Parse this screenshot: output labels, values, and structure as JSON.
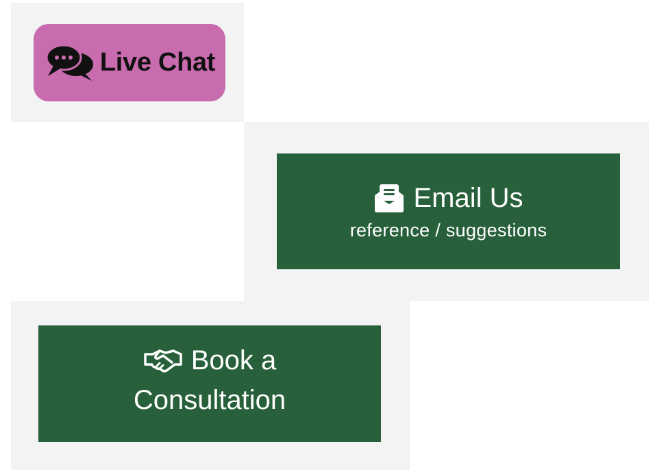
{
  "live_chat": {
    "label": "Live Chat",
    "icon": "chat-bubbles-icon",
    "color": "#c86baf"
  },
  "email": {
    "title": "Email Us",
    "subtitle": "reference / suggestions",
    "icon": "envelope-open-icon",
    "color": "#27603a"
  },
  "consultation": {
    "line1": "Book a",
    "line2": "Consultation",
    "icon": "handshake-icon",
    "color": "#27603a"
  },
  "colors": {
    "panel_background": "#f3f3f3",
    "button_text": "#ffffff",
    "chat_text": "#111111"
  }
}
